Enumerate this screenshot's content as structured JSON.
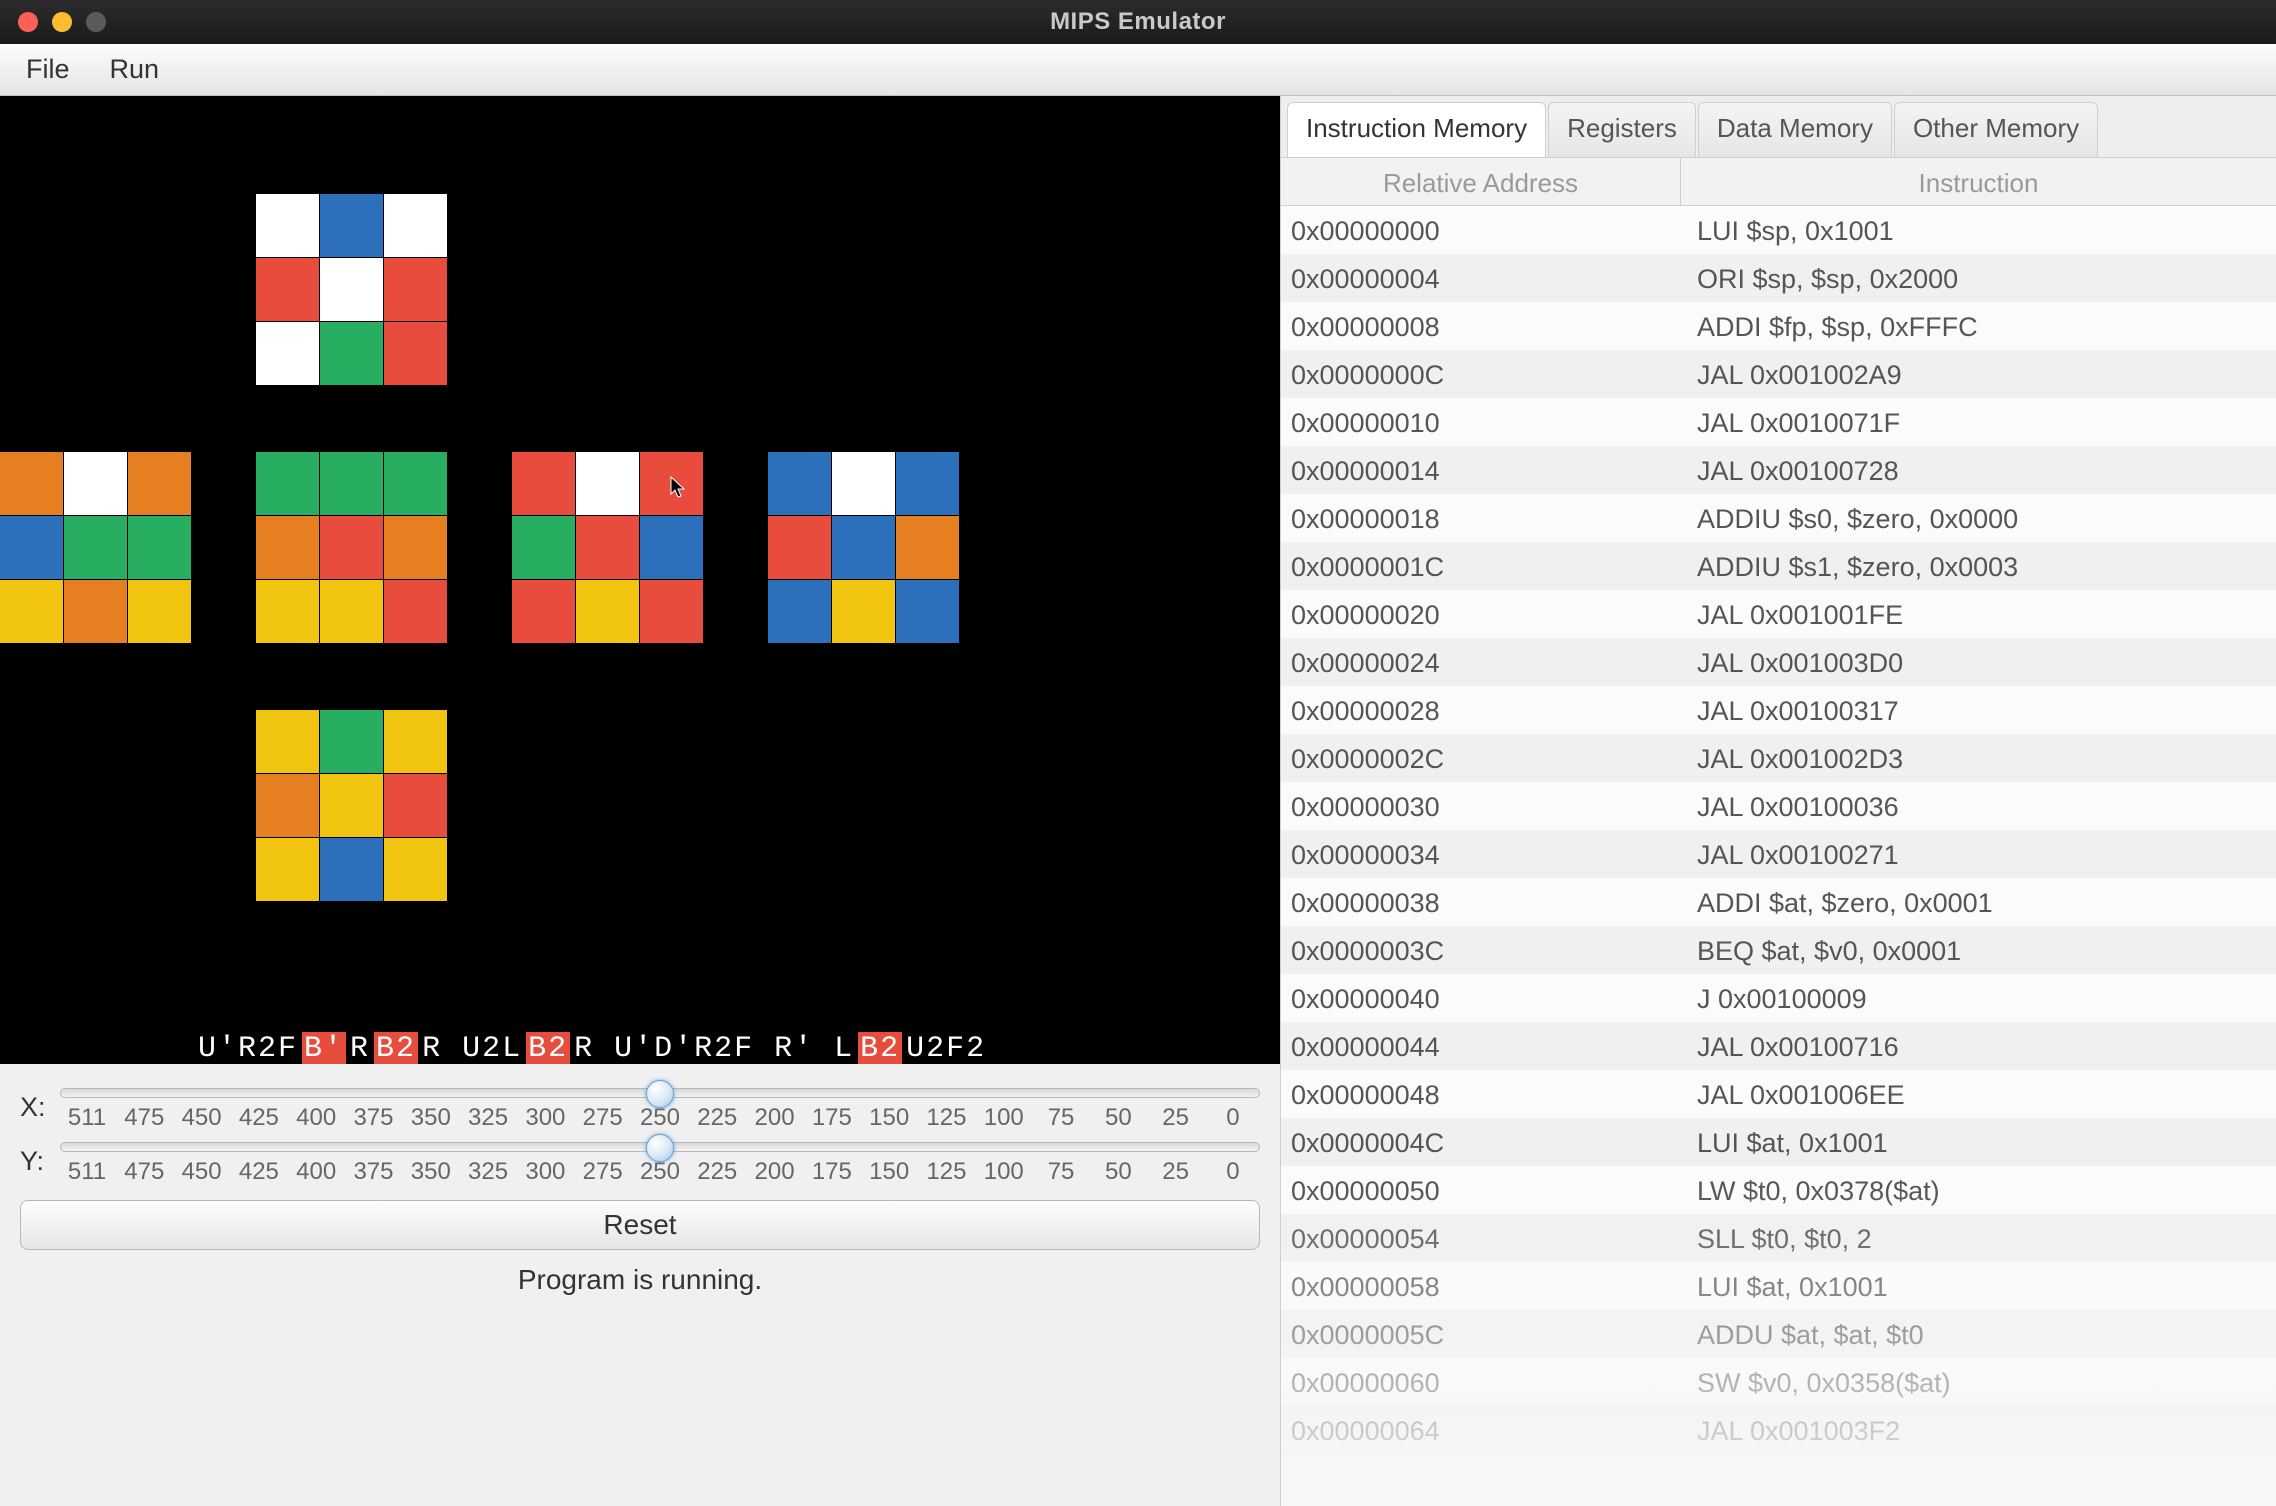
{
  "window": {
    "title": "MIPS Emulator"
  },
  "menu": {
    "file": "File",
    "run": "Run"
  },
  "cube": {
    "colors": {
      "W": "#ffffff",
      "R": "#e84c3d",
      "G": "#27ae60",
      "B": "#2c6fbb",
      "Y": "#f1c40f",
      "O": "#e67e22"
    },
    "faces": {
      "top": [
        "W",
        "B",
        "W",
        "R",
        "W",
        "R",
        "W",
        "G",
        "R"
      ],
      "l0": [
        "O",
        "W",
        "O",
        "B",
        "G",
        "G",
        "Y",
        "O",
        "Y"
      ],
      "l1": [
        "G",
        "G",
        "G",
        "O",
        "R",
        "O",
        "Y",
        "Y",
        "R"
      ],
      "l2": [
        "R",
        "W",
        "R",
        "G",
        "R",
        "B",
        "R",
        "Y",
        "R"
      ],
      "l3": [
        "B",
        "W",
        "B",
        "R",
        "B",
        "O",
        "B",
        "Y",
        "B"
      ],
      "bot": [
        "Y",
        "G",
        "Y",
        "O",
        "Y",
        "R",
        "Y",
        "B",
        "Y"
      ]
    },
    "sequence_segments": [
      {
        "t": "U'R2F ",
        "hl": false
      },
      {
        "t": "B'",
        "hl": true
      },
      {
        "t": "R ",
        "hl": false
      },
      {
        "t": "B2",
        "hl": true
      },
      {
        "t": "R U2L",
        "hl": false
      },
      {
        "t": "B2",
        "hl": true
      },
      {
        "t": "R U'D'R2F R' L",
        "hl": false
      },
      {
        "t": "B2",
        "hl": true
      },
      {
        "t": "U2F2",
        "hl": false
      }
    ]
  },
  "sliders": {
    "x": {
      "label": "X:",
      "value": 250,
      "max": 511,
      "min": 0,
      "ticks": [
        "511",
        "475",
        "450",
        "425",
        "400",
        "375",
        "350",
        "325",
        "300",
        "275",
        "250",
        "225",
        "200",
        "175",
        "150",
        "125",
        "100",
        "75",
        "50",
        "25",
        "0"
      ]
    },
    "y": {
      "label": "Y:",
      "value": 250,
      "max": 511,
      "min": 0,
      "ticks": [
        "511",
        "475",
        "450",
        "425",
        "400",
        "375",
        "350",
        "325",
        "300",
        "275",
        "250",
        "225",
        "200",
        "175",
        "150",
        "125",
        "100",
        "75",
        "50",
        "25",
        "0"
      ]
    }
  },
  "buttons": {
    "reset": "Reset"
  },
  "status": "Program is running.",
  "tabs": {
    "items": [
      "Instruction Memory",
      "Registers",
      "Data Memory",
      "Other Memory"
    ],
    "active": 0
  },
  "table": {
    "headers": {
      "addr": "Relative Address",
      "inst": "Instruction"
    },
    "rows": [
      {
        "addr": "0x00000000",
        "inst": "LUI $sp, 0x1001"
      },
      {
        "addr": "0x00000004",
        "inst": "ORI $sp, $sp, 0x2000"
      },
      {
        "addr": "0x00000008",
        "inst": "ADDI $fp, $sp, 0xFFFC"
      },
      {
        "addr": "0x0000000C",
        "inst": "JAL 0x001002A9"
      },
      {
        "addr": "0x00000010",
        "inst": "JAL 0x0010071F"
      },
      {
        "addr": "0x00000014",
        "inst": "JAL 0x00100728"
      },
      {
        "addr": "0x00000018",
        "inst": "ADDIU $s0, $zero, 0x0000"
      },
      {
        "addr": "0x0000001C",
        "inst": "ADDIU $s1, $zero, 0x0003"
      },
      {
        "addr": "0x00000020",
        "inst": "JAL 0x001001FE"
      },
      {
        "addr": "0x00000024",
        "inst": "JAL 0x001003D0"
      },
      {
        "addr": "0x00000028",
        "inst": "JAL 0x00100317"
      },
      {
        "addr": "0x0000002C",
        "inst": "JAL 0x001002D3"
      },
      {
        "addr": "0x00000030",
        "inst": "JAL 0x00100036"
      },
      {
        "addr": "0x00000034",
        "inst": "JAL 0x00100271"
      },
      {
        "addr": "0x00000038",
        "inst": "ADDI $at, $zero, 0x0001"
      },
      {
        "addr": "0x0000003C",
        "inst": "BEQ $at, $v0, 0x0001"
      },
      {
        "addr": "0x00000040",
        "inst": "J 0x00100009"
      },
      {
        "addr": "0x00000044",
        "inst": "JAL 0x00100716"
      },
      {
        "addr": "0x00000048",
        "inst": "JAL 0x001006EE"
      },
      {
        "addr": "0x0000004C",
        "inst": "LUI $at, 0x1001"
      },
      {
        "addr": "0x00000050",
        "inst": "LW $t0, 0x0378($at)"
      },
      {
        "addr": "0x00000054",
        "inst": "SLL $t0, $t0, 2"
      },
      {
        "addr": "0x00000058",
        "inst": "LUI $at, 0x1001"
      },
      {
        "addr": "0x0000005C",
        "inst": "ADDU $at, $at, $t0"
      },
      {
        "addr": "0x00000060",
        "inst": "SW $v0, 0x0358($at)"
      },
      {
        "addr": "0x00000064",
        "inst": "JAL 0x001003F2"
      }
    ]
  }
}
